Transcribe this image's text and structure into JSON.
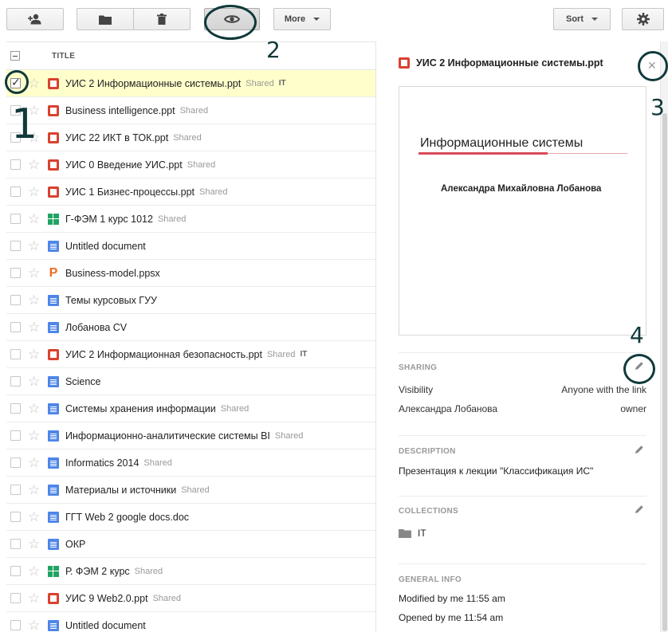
{
  "toolbar": {
    "more_label": "More",
    "sort_label": "Sort"
  },
  "annotations": {
    "n1": "1",
    "n2": "2",
    "n3": "3",
    "n4": "4"
  },
  "list": {
    "header_title": "TITLE",
    "rows": [
      {
        "name": "УИС 2 Информационные системы.ppt",
        "shared": "Shared",
        "tag": "IT",
        "type": "ppt",
        "selected": true
      },
      {
        "name": "Business intelligence.ppt",
        "shared": "Shared",
        "tag": "",
        "type": "ppt"
      },
      {
        "name": "УИС 22 ИКТ в ТОК.ppt",
        "shared": "Shared",
        "tag": "",
        "type": "ppt"
      },
      {
        "name": "УИС 0 Введение УИС.ppt",
        "shared": "Shared",
        "tag": "",
        "type": "ppt"
      },
      {
        "name": "УИС 1 Бизнес-процессы.ppt",
        "shared": "Shared",
        "tag": "",
        "type": "ppt"
      },
      {
        "name": "Г-ФЭМ 1 курс 1012",
        "shared": "Shared",
        "tag": "",
        "type": "sheet"
      },
      {
        "name": "Untitled document",
        "shared": "",
        "tag": "",
        "type": "doc"
      },
      {
        "name": "Business-model.ppsx",
        "shared": "",
        "tag": "",
        "type": "pps"
      },
      {
        "name": "Темы курсовых ГУУ",
        "shared": "",
        "tag": "",
        "type": "doc"
      },
      {
        "name": "Лобанова CV",
        "shared": "",
        "tag": "",
        "type": "doc"
      },
      {
        "name": "УИС 2 Информационная безопасность.ppt",
        "shared": "Shared",
        "tag": "IT",
        "type": "ppt"
      },
      {
        "name": "Science",
        "shared": "",
        "tag": "",
        "type": "doc"
      },
      {
        "name": "Системы хранения информации",
        "shared": "Shared",
        "tag": "",
        "type": "doc"
      },
      {
        "name": "Информационно-аналитические системы BI",
        "shared": "Shared",
        "tag": "",
        "type": "doc"
      },
      {
        "name": "Informatics 2014",
        "shared": "Shared",
        "tag": "",
        "type": "doc"
      },
      {
        "name": "Материалы и источники",
        "shared": "Shared",
        "tag": "",
        "type": "doc"
      },
      {
        "name": "ГГТ Web 2 google docs.doc",
        "shared": "",
        "tag": "",
        "type": "doc"
      },
      {
        "name": "ОКР",
        "shared": "",
        "tag": "",
        "type": "doc"
      },
      {
        "name": "Р. ФЭМ 2 курс",
        "shared": "Shared",
        "tag": "",
        "type": "sheet"
      },
      {
        "name": "УИС 9 Web2.0.ppt",
        "shared": "Shared",
        "tag": "",
        "type": "ppt"
      },
      {
        "name": "Untitled document",
        "shared": "",
        "tag": "",
        "type": "doc"
      }
    ]
  },
  "details": {
    "title": "УИС 2 Информационные системы.ppt",
    "close_glyph": "✕",
    "preview_heading": "Информационные системы",
    "preview_author": "Александра Михайловна Лобанова",
    "sharing_label": "SHARING",
    "visibility_label": "Visibility",
    "visibility_value": "Anyone with the link",
    "owner_name": "Александра Лобанова",
    "owner_role": "owner",
    "description_label": "DESCRIPTION",
    "description_text": "Презентация к лекции \"Классификация ИС\"",
    "collections_label": "COLLECTIONS",
    "collection_name": "IT",
    "general_label": "GENERAL INFO",
    "modified": "Modified by me 11:55 am",
    "opened": "Opened by me 11:54 am"
  }
}
